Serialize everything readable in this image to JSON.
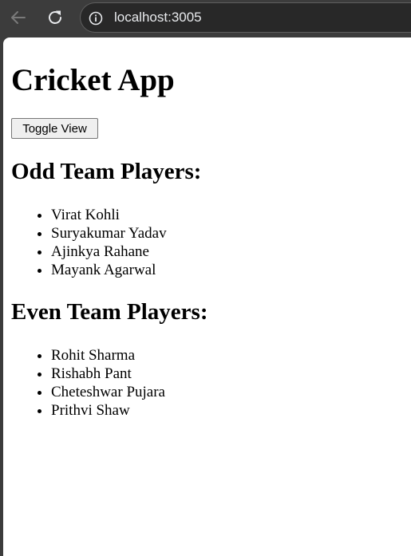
{
  "browser": {
    "url": "localhost:3005",
    "icons": {
      "back": "arrow-left-icon",
      "reload": "reload-icon",
      "site_info": "info-icon"
    }
  },
  "app": {
    "title": "Cricket App",
    "toggle_button_label": "Toggle View",
    "odd_team": {
      "heading": "Odd Team Players:",
      "players": [
        "Virat Kohli",
        "Suryakumar Yadav",
        "Ajinkya Rahane",
        "Mayank Agarwal"
      ]
    },
    "even_team": {
      "heading": "Even Team Players:",
      "players": [
        "Rohit Sharma",
        "Rishabh Pant",
        "Cheteshwar Pujara",
        "Prithvi Shaw"
      ]
    }
  }
}
